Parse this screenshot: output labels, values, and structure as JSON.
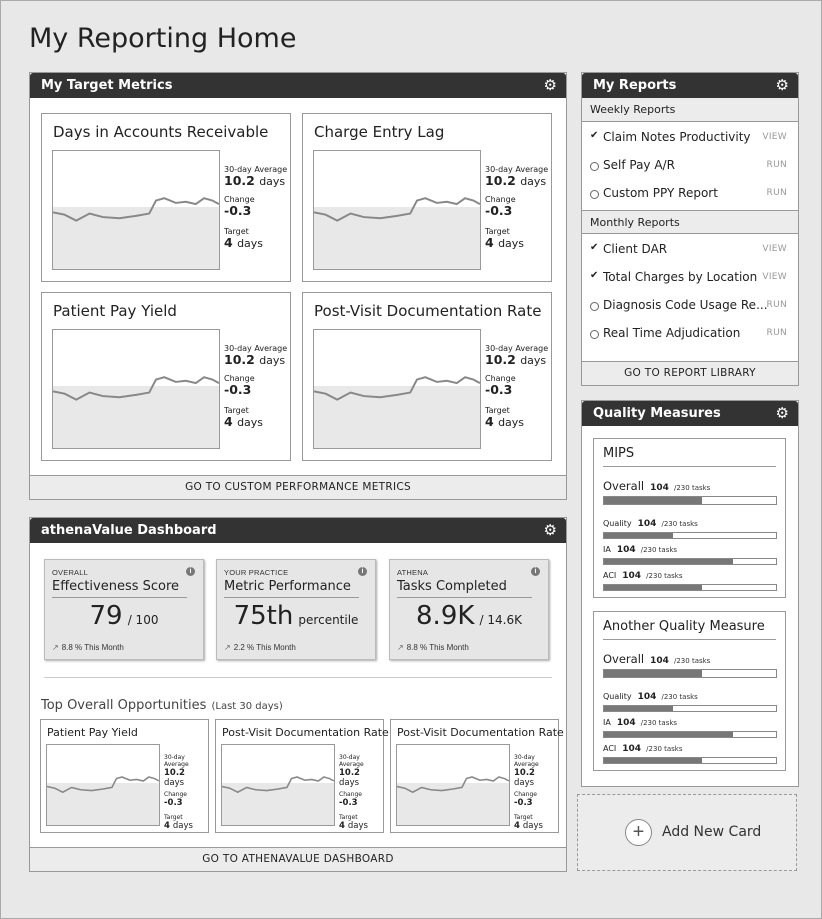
{
  "page": {
    "title": "My Reporting Home"
  },
  "target_metrics": {
    "title": "My Target Metrics",
    "footer_link": "GO TO CUSTOM PERFORMANCE METRICS",
    "cards": [
      {
        "title": "Days in Accounts Receivable",
        "avg_label": "30-day Average",
        "avg_value": "10.2",
        "avg_unit": "days",
        "change_label": "Change",
        "change_value": "-0.3",
        "target_label": "Target",
        "target_value": "4",
        "target_unit": "days"
      },
      {
        "title": "Charge Entry Lag",
        "avg_label": "30-day Average",
        "avg_value": "10.2",
        "avg_unit": "days",
        "change_label": "Change",
        "change_value": "-0.3",
        "target_label": "Target",
        "target_value": "4",
        "target_unit": "days"
      },
      {
        "title": "Patient Pay Yield",
        "avg_label": "30-day Average",
        "avg_value": "10.2",
        "avg_unit": "days",
        "change_label": "Change",
        "change_value": "-0.3",
        "target_label": "Target",
        "target_value": "4",
        "target_unit": "days"
      },
      {
        "title": "Post-Visit Documentation Rate",
        "avg_label": "30-day Average",
        "avg_value": "10.2",
        "avg_unit": "days",
        "change_label": "Change",
        "change_value": "-0.3",
        "target_label": "Target",
        "target_value": "4",
        "target_unit": "days"
      }
    ]
  },
  "value_dashboard": {
    "title": "athenaValue Dashboard",
    "kpis": [
      {
        "category": "OVERALL",
        "title": "Effectiveness Score",
        "value": "79",
        "suffix": "/ 100",
        "trend": "8.8 % This Month"
      },
      {
        "category": "YOUR PRACTICE",
        "title": "Metric Performance",
        "value": "75th",
        "suffix": "percentile",
        "trend": "2.2 % This Month"
      },
      {
        "category": "ATHENA",
        "title": "Tasks Completed",
        "value": "8.9K",
        "suffix": "/ 14.6K",
        "trend": "8.8 % This Month"
      }
    ],
    "opportunities_title": "Top Overall Opportunities",
    "opportunities_period": "(Last 30 days)",
    "opportunities": [
      {
        "title": "Patient Pay Yield",
        "avg_label": "30-day Average",
        "avg_value": "10.2",
        "avg_unit": "days",
        "change_label": "Change",
        "change_value": "-0.3",
        "target_label": "Target",
        "target_value": "4",
        "target_unit": "days"
      },
      {
        "title": "Post-Visit Documentation Rate",
        "avg_label": "30-day Average",
        "avg_value": "10.2",
        "avg_unit": "days",
        "change_label": "Change",
        "change_value": "-0.3",
        "target_label": "Target",
        "target_value": "4",
        "target_unit": "days"
      },
      {
        "title": "Post-Visit Documentation Rate",
        "avg_label": "30-day Average",
        "avg_value": "10.2",
        "avg_unit": "days",
        "change_label": "Change",
        "change_value": "-0.3",
        "target_label": "Target",
        "target_value": "4",
        "target_unit": "days"
      }
    ],
    "footer_link": "GO TO ATHENAVALUE DASHBOARD"
  },
  "my_reports": {
    "title": "My Reports",
    "weekly_label": "Weekly Reports",
    "weekly": [
      {
        "name": "Claim Notes Productivity",
        "action": "VIEW",
        "state": "checked"
      },
      {
        "name": "Self Pay A/R",
        "action": "RUN",
        "state": "open"
      },
      {
        "name": "Custom PPY Report",
        "action": "RUN",
        "state": "open"
      }
    ],
    "monthly_label": "Monthly Reports",
    "monthly": [
      {
        "name": "Client DAR",
        "action": "VIEW",
        "state": "checked"
      },
      {
        "name": "Total Charges by Location",
        "action": "VIEW",
        "state": "checked"
      },
      {
        "name": "Diagnosis Code Usage Re...",
        "action": "RUN",
        "state": "open"
      },
      {
        "name": "Real Time Adjudication",
        "action": "RUN",
        "state": "open"
      }
    ],
    "footer_link": "GO TO REPORT LIBRARY"
  },
  "quality_measures": {
    "title": "Quality Measures",
    "groups": [
      {
        "title": "MIPS",
        "rows": [
          {
            "label": "Overall",
            "count": "104",
            "total": "/230 tasks",
            "fraction": 0.57
          },
          {
            "label": "Quality",
            "count": "104",
            "total": "/230 tasks",
            "fraction": 0.4
          },
          {
            "label": "IA",
            "count": "104",
            "total": "/230 tasks",
            "fraction": 0.75
          },
          {
            "label": "ACI",
            "count": "104",
            "total": "/230 tasks",
            "fraction": 0.57
          }
        ]
      },
      {
        "title": "Another Quality Measure",
        "rows": [
          {
            "label": "Overall",
            "count": "104",
            "total": "/230 tasks",
            "fraction": 0.57
          },
          {
            "label": "Quality",
            "count": "104",
            "total": "/230 tasks",
            "fraction": 0.4
          },
          {
            "label": "IA",
            "count": "104",
            "total": "/230 tasks",
            "fraction": 0.75
          },
          {
            "label": "ACI",
            "count": "104",
            "total": "/230 tasks",
            "fraction": 0.57
          }
        ]
      }
    ]
  },
  "add_card": {
    "label": "Add New Card"
  },
  "icons": {
    "settings": "gear-icon",
    "info": "info-icon",
    "trend": "trend-arrow-icon",
    "add": "plus-icon"
  }
}
